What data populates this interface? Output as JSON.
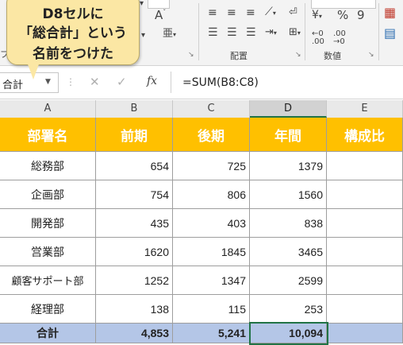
{
  "callout": {
    "line1": "D8セルに",
    "line2": "「総合計」という",
    "line3": "名前をつけた"
  },
  "ribbon": {
    "group_alignment_label": "配置",
    "group_number_label": "数値",
    "font_size_smaller_glyph": "A",
    "currency_glyph": "¥",
    "percent_glyph": "%",
    "comma_glyph": "9",
    "phonetic_glyph": "亜",
    "clipped_left_label": "フ"
  },
  "formula_bar": {
    "name_box_value": "合計",
    "cancel_glyph": "✕",
    "enter_glyph": "✓",
    "fx_glyph": "fx",
    "formula": "=SUM(B8:C8)"
  },
  "columns": [
    "A",
    "B",
    "C",
    "D",
    "E"
  ],
  "selected_column": "D",
  "table": {
    "headers": [
      "部署名",
      "前期",
      "後期",
      "年間",
      "構成比"
    ],
    "rows": [
      {
        "dept": "総務部",
        "first": "654",
        "second": "725",
        "year": "1379"
      },
      {
        "dept": "企画部",
        "first": "754",
        "second": "806",
        "year": "1560"
      },
      {
        "dept": "開発部",
        "first": "435",
        "second": "403",
        "year": "838"
      },
      {
        "dept": "営業部",
        "first": "1620",
        "second": "1845",
        "year": "3465"
      },
      {
        "dept": "顧客サポート部",
        "first": "1252",
        "second": "1347",
        "year": "2599"
      },
      {
        "dept": "経理部",
        "first": "138",
        "second": "115",
        "year": "253"
      }
    ],
    "total": {
      "dept": "合計",
      "first": "4,853",
      "second": "5,241",
      "year": "10,094"
    }
  },
  "colors": {
    "header_fill": "#ffc000",
    "total_fill": "#b4c6e7",
    "selection_green": "#217346"
  }
}
